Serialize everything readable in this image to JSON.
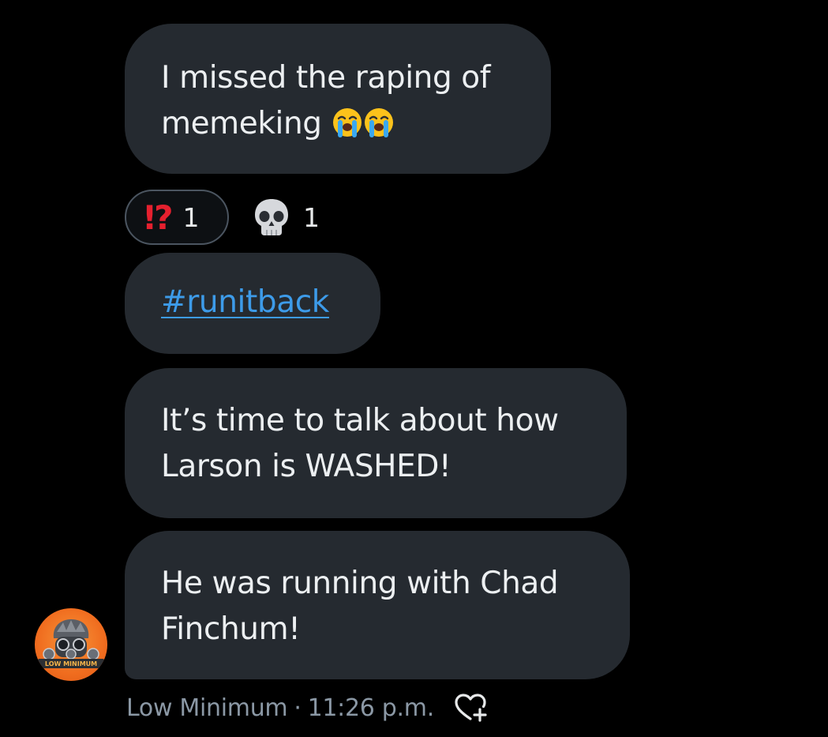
{
  "messages": [
    {
      "text": "I missed the raping of",
      "text_line2": "memeking"
    },
    {
      "hashtag": "#runitback"
    },
    {
      "line1": "It’s time to talk about how",
      "line2": "Larson is WASHED!"
    },
    {
      "line1": "He was running with Chad",
      "line2": "Finchum!"
    }
  ],
  "reactions": [
    {
      "emoji": "⁉",
      "icon": "interrobang-emoji",
      "count": "1"
    },
    {
      "emoji": "💀",
      "icon": "skull-emoji",
      "count": "1"
    }
  ],
  "avatar": {
    "label": "LOW MINIMUM",
    "icon": "gas-mask-avatar"
  },
  "meta": {
    "sender": "Low Minimum",
    "separator": "·",
    "time": "11:26 p.m.",
    "like_icon": "heart-plus-icon"
  },
  "colors": {
    "background": "#000000",
    "bubble": "#252a30",
    "hashtag": "#3d9be9",
    "meta_text": "#8b98a5",
    "interrobang": "#e5202e"
  }
}
